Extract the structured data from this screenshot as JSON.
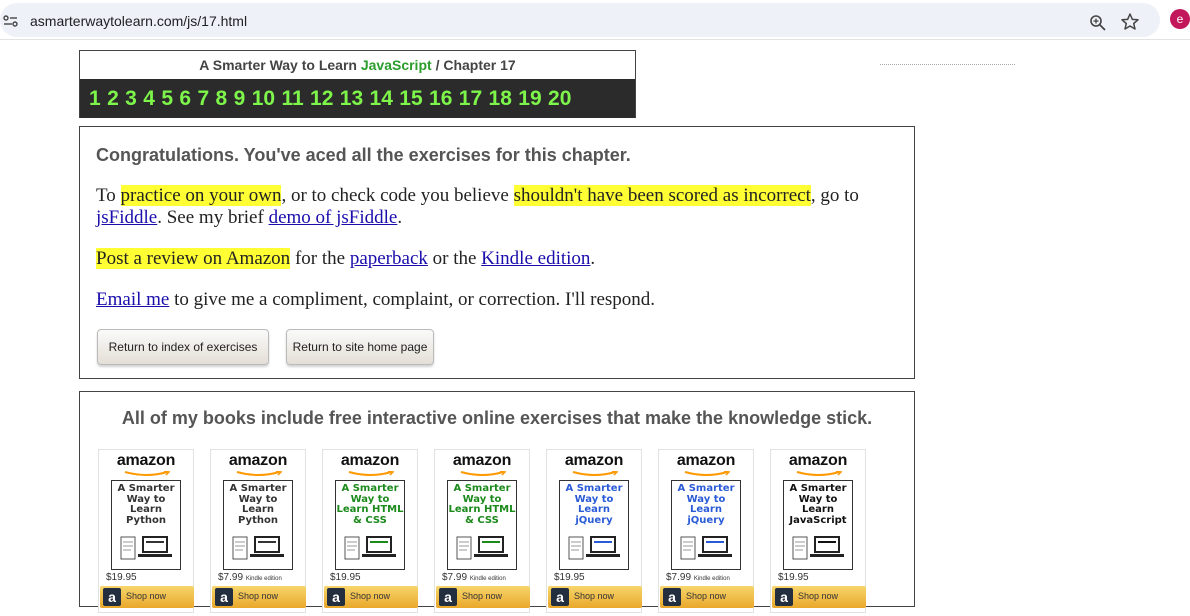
{
  "browser": {
    "url": "asmarterwaytolearn.com/js/17.html",
    "avatar_letter": "e"
  },
  "chapter_nav": {
    "title_prefix": "A Smarter Way to Learn",
    "title_js": "JavaScript",
    "title_sep": "/",
    "title_chapter": "Chapter 17",
    "numbers": [
      "1",
      "2",
      "3",
      "4",
      "5",
      "6",
      "7",
      "8",
      "9",
      "10",
      "11",
      "12",
      "13",
      "14",
      "15",
      "16",
      "17",
      "18",
      "19",
      "20"
    ]
  },
  "congrats": {
    "heading": "Congratulations. You've aced all the exercises for this chapter.",
    "p1": {
      "t1": "To ",
      "hl1": "practice on your own",
      "t2": ", or to check code you believe ",
      "hl2": "shouldn't have been scored as incorrect",
      "t3": ", go to ",
      "link1": "jsFiddle",
      "t4": ". See my brief ",
      "link2": "demo of jsFiddle",
      "t5": "."
    },
    "p2": {
      "hl": "Post a review on Amazon",
      "t1": " for the ",
      "link1": "paperback",
      "t2": " or the ",
      "link2": "Kindle edition",
      "t3": "."
    },
    "p3": {
      "link": "Email me",
      "t1": " to give me a compliment, complaint, or correction. I'll respond."
    },
    "btn_index": "Return to index of exercises",
    "btn_home": "Return to site home page"
  },
  "books": {
    "heading": "All of my books include free interactive online exercises that make the knowledge stick.",
    "brand": "amazon",
    "shop_label": "Shop now",
    "shop_logo": "a",
    "items": [
      {
        "title": "A Smarter Way to Learn Python",
        "price": "$19.95",
        "edition": "",
        "color": "#333333"
      },
      {
        "title": "A Smarter Way to Learn Python",
        "price": "$7.99",
        "edition": "Kindle edition",
        "color": "#333333"
      },
      {
        "title": "A Smarter Way to Learn HTML & CSS",
        "price": "$19.95",
        "edition": "",
        "color": "#1b8a1b"
      },
      {
        "title": "A Smarter Way to Learn HTML & CSS",
        "price": "$7.99",
        "edition": "Kindle edition",
        "color": "#1b8a1b"
      },
      {
        "title": "A Smarter Way to Learn jQuery",
        "price": "$19.95",
        "edition": "",
        "color": "#2a5bd7"
      },
      {
        "title": "A Smarter Way to Learn jQuery",
        "price": "$7.99",
        "edition": "Kindle edition",
        "color": "#2a5bd7"
      },
      {
        "title": "A Smarter Way to Learn JavaScript",
        "price": "$19.95",
        "edition": "",
        "color": "#111111"
      }
    ]
  }
}
